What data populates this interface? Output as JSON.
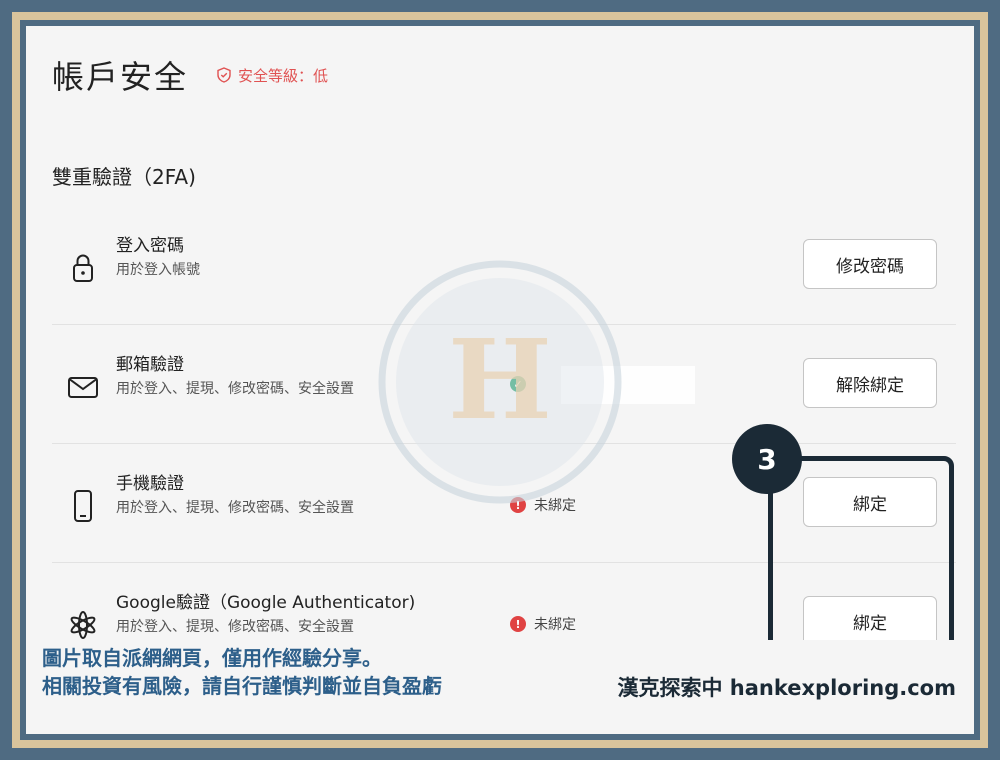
{
  "header": {
    "title": "帳戶安全",
    "security_level": "安全等級：低"
  },
  "section": {
    "title": "雙重驗證（2FA)"
  },
  "items": [
    {
      "name": "登入密碼",
      "desc": "用於登入帳號",
      "status": "",
      "button": "修改密碼",
      "icon": "lock-icon"
    },
    {
      "name": "郵箱驗證",
      "desc": "用於登入、提現、修改密碼、安全設置",
      "status": "",
      "status_icon": "check-circle-icon",
      "button": "解除綁定",
      "icon": "mail-icon"
    },
    {
      "name": "手機驗證",
      "desc": "用於登入、提現、修改密碼、安全設置",
      "status": "未綁定",
      "status_icon": "alert-circle-icon",
      "button": "綁定",
      "icon": "phone-icon"
    },
    {
      "name": "Google驗證（Google Authenticator)",
      "desc": "用於登入、提現、修改密碼、安全設置",
      "status": "未綁定",
      "status_icon": "alert-circle-icon",
      "button": "綁定",
      "icon": "authenticator-icon"
    }
  ],
  "annotation": {
    "step": "3"
  },
  "watermark": {
    "text": "H"
  },
  "footer": {
    "line1": "圖片取自派網網頁，僅用作經驗分享。",
    "line2": "相關投資有風險，請自行謹慎判斷並自負盈虧",
    "brand": "漢克探索中 hankexploring.com"
  },
  "colors": {
    "accent_error": "#e04343",
    "accent_ok": "#1e9e6b",
    "frame": "#4f6b82",
    "frame_border": "#d9c49c",
    "highlight": "#1b2a36"
  }
}
